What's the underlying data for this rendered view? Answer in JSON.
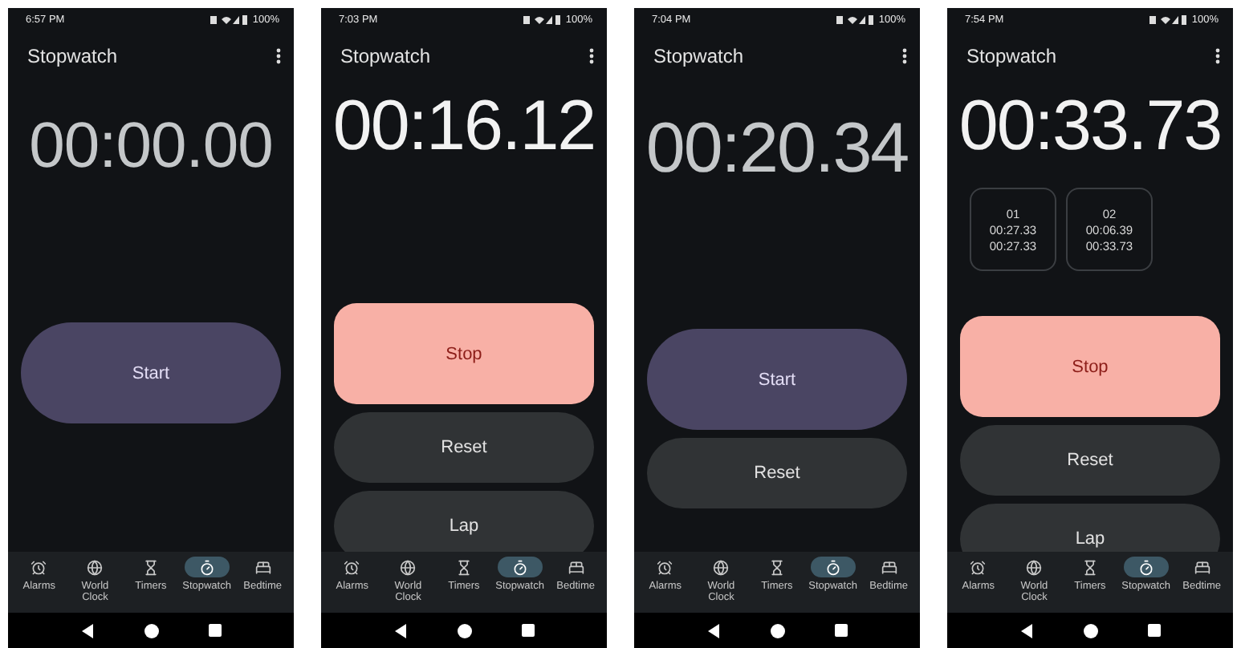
{
  "screens": [
    {
      "status_bar": {
        "time": "6:57 PM",
        "battery": "100%"
      },
      "app_bar": {
        "title": "Stopwatch"
      },
      "display": {
        "time": "00:00.00",
        "kind": "reset"
      },
      "buttons": [
        {
          "label": "Start",
          "kind": "start"
        }
      ],
      "nav": [
        {
          "label": "Alarms",
          "selected": false
        },
        {
          "label": "World Clock",
          "selected": false
        },
        {
          "label": "Timers",
          "selected": false
        },
        {
          "label": "Stopwatch",
          "selected": true
        },
        {
          "label": "Bedtime",
          "selected": false
        }
      ]
    },
    {
      "status_bar": {
        "time": "7:03 PM",
        "battery": "100%"
      },
      "app_bar": {
        "title": "Stopwatch"
      },
      "display": {
        "time": "00:16.12",
        "kind": "running"
      },
      "buttons": [
        {
          "label": "Stop",
          "kind": "stop"
        },
        {
          "label": "Reset",
          "kind": "secondary"
        },
        {
          "label": "Lap",
          "kind": "secondary"
        }
      ],
      "nav": [
        {
          "label": "Alarms",
          "selected": false
        },
        {
          "label": "World Clock",
          "selected": false
        },
        {
          "label": "Timers",
          "selected": false
        },
        {
          "label": "Stopwatch",
          "selected": true
        },
        {
          "label": "Bedtime",
          "selected": false
        }
      ]
    },
    {
      "status_bar": {
        "time": "7:04 PM",
        "battery": "100%"
      },
      "app_bar": {
        "title": "Stopwatch"
      },
      "display": {
        "time": "00:20.34",
        "kind": "paused"
      },
      "buttons": [
        {
          "label": "Start",
          "kind": "start"
        },
        {
          "label": "Reset",
          "kind": "secondary"
        }
      ],
      "nav": [
        {
          "label": "Alarms",
          "selected": false
        },
        {
          "label": "World Clock",
          "selected": false
        },
        {
          "label": "Timers",
          "selected": false
        },
        {
          "label": "Stopwatch",
          "selected": true
        },
        {
          "label": "Bedtime",
          "selected": false
        }
      ]
    },
    {
      "status_bar": {
        "time": "7:54 PM",
        "battery": "100%"
      },
      "app_bar": {
        "title": "Stopwatch"
      },
      "display": {
        "time": "00:33.73",
        "kind": "running"
      },
      "laps": [
        {
          "number": "01",
          "lap_time": "00:27.33",
          "total_time": "00:27.33"
        },
        {
          "number": "02",
          "lap_time": "00:06.39",
          "total_time": "00:33.73"
        }
      ],
      "buttons": [
        {
          "label": "Stop",
          "kind": "stop"
        },
        {
          "label": "Reset",
          "kind": "secondary"
        },
        {
          "label": "Lap",
          "kind": "secondary"
        }
      ],
      "nav": [
        {
          "label": "Alarms",
          "selected": false
        },
        {
          "label": "World Clock",
          "selected": false
        },
        {
          "label": "Timers",
          "selected": false
        },
        {
          "label": "Stopwatch",
          "selected": true
        },
        {
          "label": "Bedtime",
          "selected": false
        }
      ]
    }
  ]
}
